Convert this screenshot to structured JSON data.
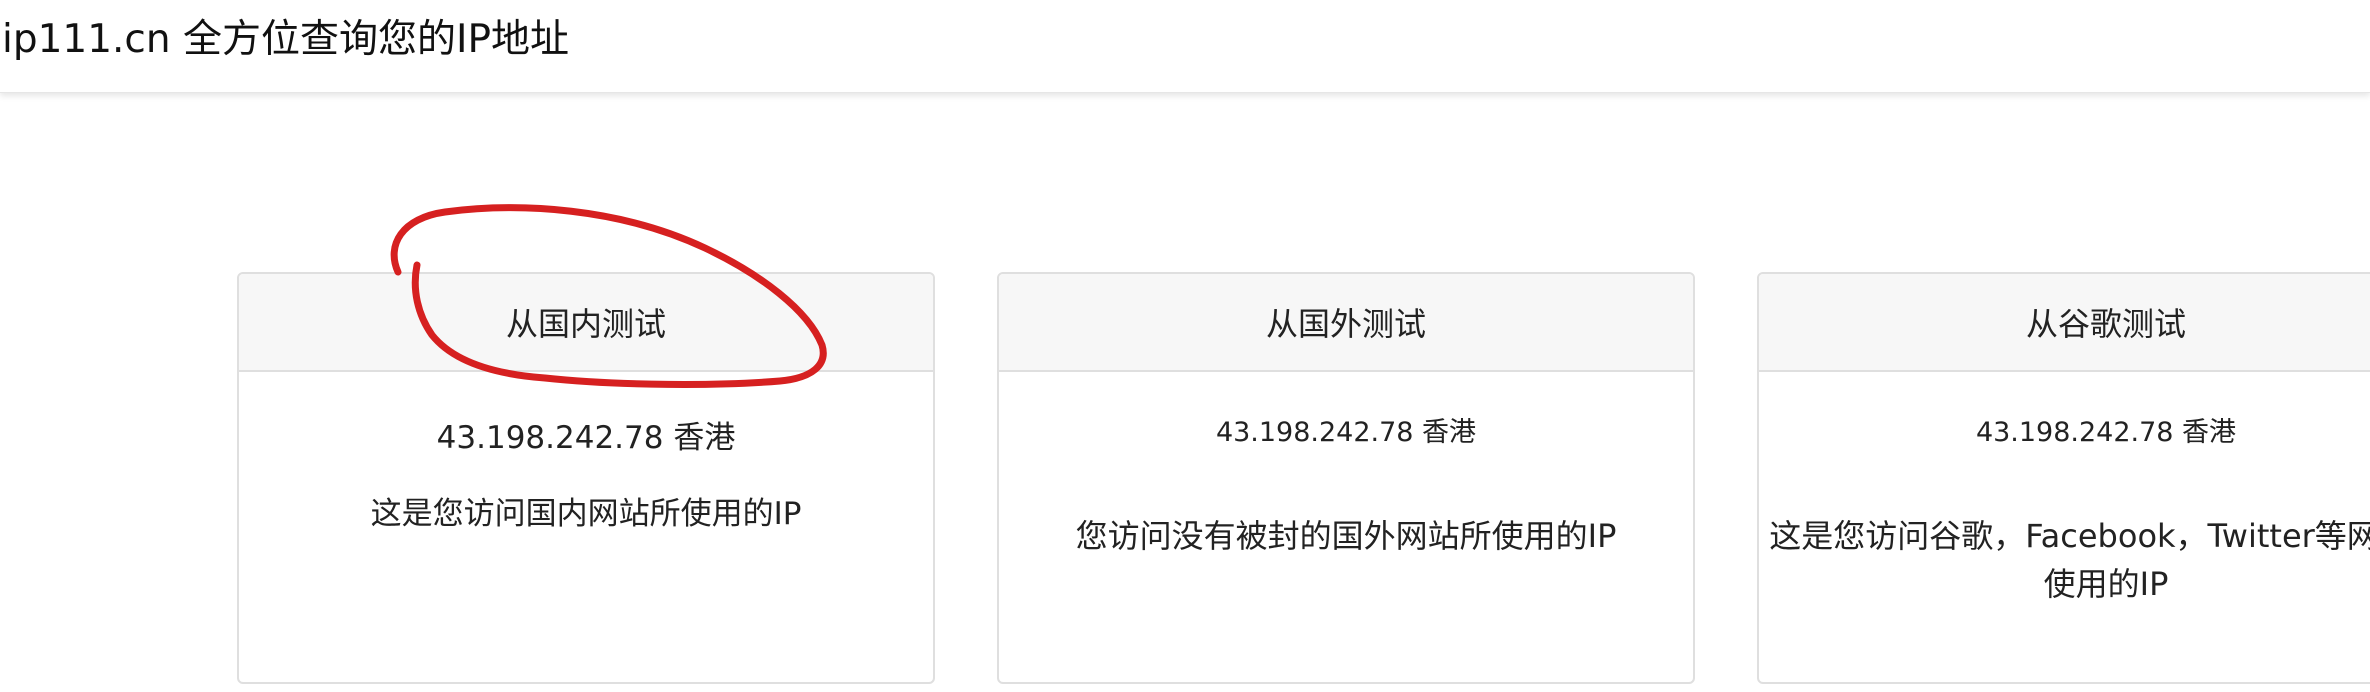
{
  "navbar": {
    "brand": "ip111.cn 全方位查询您的IP地址"
  },
  "cards": {
    "domestic": {
      "title": "从国内测试",
      "ip": "43.198.242.78 香港",
      "description": "这是您访问国内网站所使用的IP"
    },
    "foreign": {
      "title": "从国外测试",
      "ip": "43.198.242.78 香港",
      "description": "您访问没有被封的国外网站所使用的IP"
    },
    "google": {
      "title": "从谷歌测试",
      "ip": "43.198.242.78 香港",
      "description": "这是您访问谷歌，Facebook，Twitter等网站所使用的IP"
    }
  },
  "annotation": {
    "shape": "freehand-ellipse",
    "target": "cards.domestic.title",
    "color": "#d62020"
  }
}
